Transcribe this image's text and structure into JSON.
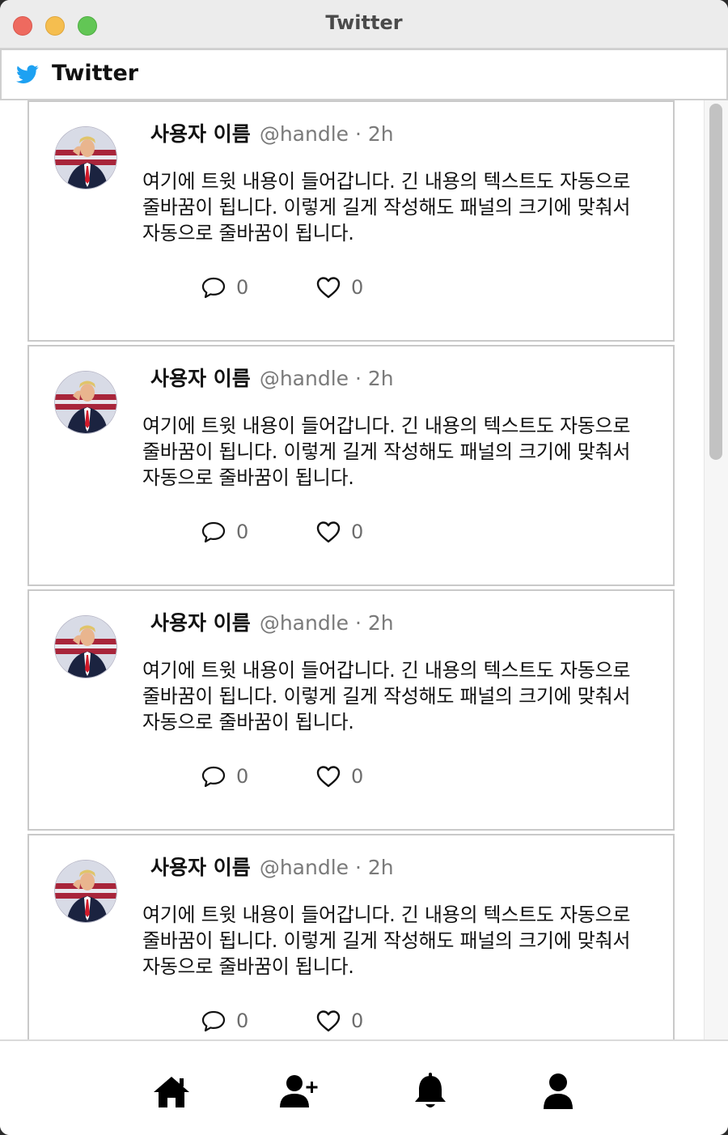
{
  "window": {
    "title": "Twitter"
  },
  "header": {
    "icon": "twitter-bird-icon",
    "title": "Twitter",
    "brand_color": "#1da1f2"
  },
  "tweets": [
    {
      "username": "사용자 이름",
      "handle_time": "@handle · 2h",
      "text": "여기에 트윗 내용이 들어갑니다. 긴 내용의 텍스트도 자동으로 줄바꿈이 됩니다. 이렇게 길게 작성해도 패널의 크기에 맞춰서 자동으로 줄바꿈이 됩니다.",
      "reply_count": "0",
      "like_count": "0"
    },
    {
      "username": "사용자 이름",
      "handle_time": "@handle · 2h",
      "text": "여기에 트윗 내용이 들어갑니다. 긴 내용의 텍스트도 자동으로 줄바꿈이 됩니다. 이렇게 길게 작성해도 패널의 크기에 맞춰서 자동으로 줄바꿈이 됩니다.",
      "reply_count": "0",
      "like_count": "0"
    },
    {
      "username": "사용자 이름",
      "handle_time": "@handle · 2h",
      "text": "여기에 트윗 내용이 들어갑니다. 긴 내용의 텍스트도 자동으로 줄바꿈이 됩니다. 이렇게 길게 작성해도 패널의 크기에 맞춰서 자동으로 줄바꿈이 됩니다.",
      "reply_count": "0",
      "like_count": "0"
    },
    {
      "username": "사용자 이름",
      "handle_time": "@handle · 2h",
      "text": "여기에 트윗 내용이 들어갑니다. 긴 내용의 텍스트도 자동으로 줄바꿈이 됩니다. 이렇게 길게 작성해도 패널의 크기에 맞춰서 자동으로 줄바꿈이 됩니다.",
      "reply_count": "0",
      "like_count": "0"
    }
  ],
  "bottom_nav": {
    "items": [
      {
        "icon": "home-icon"
      },
      {
        "icon": "add-user-icon"
      },
      {
        "icon": "bell-icon"
      },
      {
        "icon": "profile-icon"
      }
    ]
  }
}
